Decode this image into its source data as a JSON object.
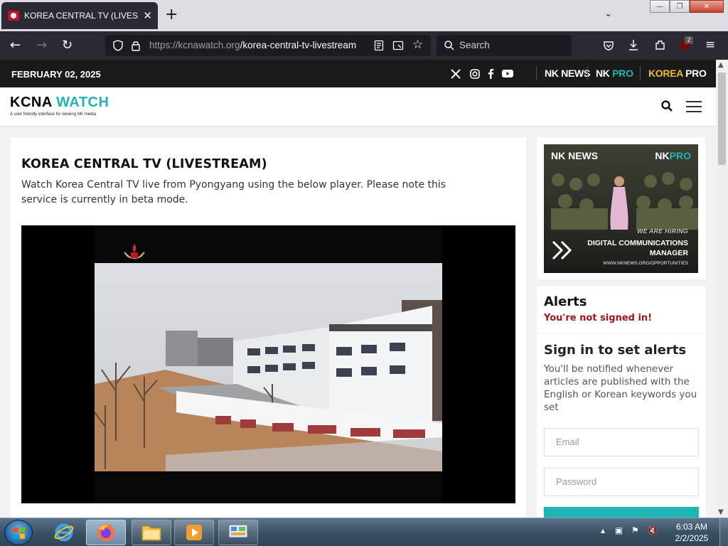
{
  "browser": {
    "tab_title": "KOREA CENTRAL TV (LIVESTREAM)",
    "new_tab_label": "+",
    "url_domain": "https://kcnawatch.org",
    "url_path": "/korea-central-tv-livestream",
    "search_placeholder": "Search",
    "extension_badge": "2"
  },
  "site": {
    "date": "FEBRUARY 02, 2025",
    "brands": {
      "nknews": "NK NEWS",
      "nkpro_a": "NK ",
      "nkpro_b": "PRO",
      "koreapro_a": "KOREA ",
      "koreapro_b": "PRO"
    },
    "logo_a": "KCNA ",
    "logo_b": "WATCH",
    "tagline": "A user friendly interface for viewing NK media"
  },
  "article": {
    "title": "KOREA CENTRAL TV (LIVESTREAM)",
    "description": "Watch Korea Central TV live from Pyongyang using the below player. Please note this service is currently in beta mode."
  },
  "ad": {
    "nknews": "NK NEWS",
    "nkpro_a": "NK",
    "nkpro_b": "PRO",
    "hiring": "WE ARE HIRING",
    "role_1": "DIGITAL COMMUNICATIONS",
    "role_2": "MANAGER",
    "url": "WWW.NKNEWS.ORG/OPPORTUNITIES"
  },
  "alerts": {
    "title": "Alerts",
    "status": "You're not signed in!",
    "signin_title": "Sign in to set alerts",
    "signin_desc": "You'll be notified whenever articles are published with the English or Korean keywords you set",
    "email_placeholder": "Email",
    "password_placeholder": "Password"
  },
  "taskbar": {
    "time": "6:03 AM",
    "date": "2/2/2025"
  },
  "colors": {
    "accent_teal": "#1fb5b5",
    "alert_red": "#a4141c",
    "koreapro_yellow": "#f0b93a"
  }
}
